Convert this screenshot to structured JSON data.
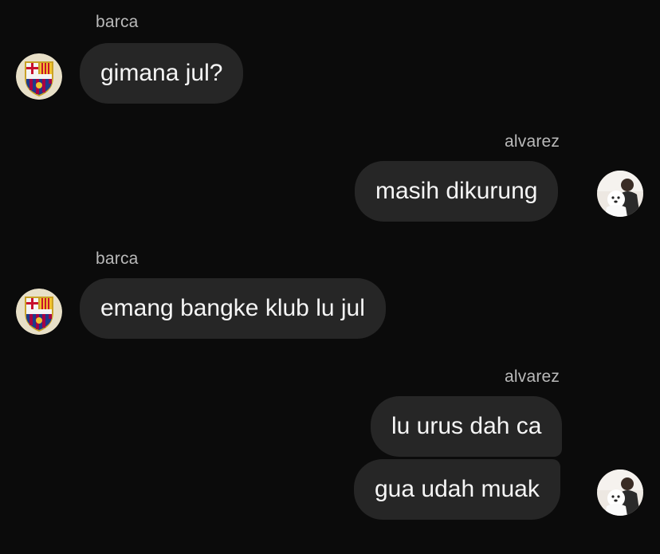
{
  "thread": {
    "messages": [
      {
        "sender": "barca",
        "text": "gimana jul?",
        "side": "incoming"
      },
      {
        "sender": "alvarez",
        "text": "masih dikurung",
        "side": "outgoing"
      },
      {
        "sender": "barca",
        "text": "emang bangke klub lu jul",
        "side": "incoming"
      },
      {
        "sender": "alvarez",
        "text": "lu urus dah ca",
        "side": "outgoing"
      },
      {
        "sender": "alvarez",
        "text": "gua udah muak",
        "side": "outgoing"
      }
    ]
  },
  "avatars": {
    "barca": "fc-barcelona-crest-icon",
    "alvarez": "profile-photo-icon"
  },
  "colors": {
    "background": "#0b0b0b",
    "bubble": "#262626",
    "sender_label": "#b9b9b9",
    "text": "#f5f5f5"
  }
}
